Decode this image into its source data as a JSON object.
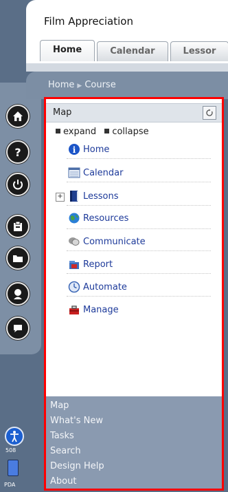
{
  "app": {
    "title": "Film Appreciation"
  },
  "tabs": [
    "Home",
    "Calendar",
    "Lessor"
  ],
  "breadcrumb": {
    "home": "Home",
    "course": "Course"
  },
  "map": {
    "title": "Map",
    "controls": {
      "expand": "expand",
      "collapse": "collapse"
    },
    "items": [
      {
        "label": "Home",
        "icon": "info-icon"
      },
      {
        "label": "Calendar",
        "icon": "calendar-icon"
      },
      {
        "label": "Lessons",
        "icon": "book-icon"
      },
      {
        "label": "Resources",
        "icon": "globe-icon"
      },
      {
        "label": "Communicate",
        "icon": "chat-icon"
      },
      {
        "label": "Report",
        "icon": "report-icon"
      },
      {
        "label": "Automate",
        "icon": "clock-icon"
      },
      {
        "label": "Manage",
        "icon": "toolbox-icon"
      }
    ],
    "bottom_links": [
      "Map",
      "What's New",
      "Tasks",
      "Search",
      "Design Help",
      "About"
    ]
  },
  "sidebar": {
    "accessibility_label": "508",
    "pda_label": "PDA"
  },
  "colors": {
    "panel_border": "#ff0000",
    "link": "#1d3a9a",
    "chrome": "#5a6e87"
  }
}
